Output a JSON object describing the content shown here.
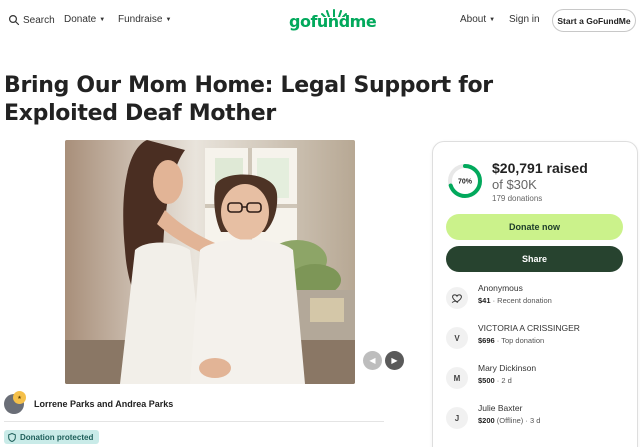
{
  "nav": {
    "search": "Search",
    "donate": "Donate",
    "fundraise": "Fundraise",
    "logo": "gofundme",
    "about": "About",
    "signin": "Sign in",
    "start": "Start a GoFundMe"
  },
  "campaign": {
    "title": "Bring Our Mom Home: Legal Support for Exploited Deaf Mother",
    "organizers": "Lorrene Parks and Andrea Parks",
    "protected": "Donation protected"
  },
  "progress": {
    "percent_label": "70%",
    "percent": 0.7,
    "raised": "$20,791 raised",
    "goal": "of $30K",
    "donations": "179 donations"
  },
  "actions": {
    "donate": "Donate now",
    "share": "Share"
  },
  "donations": [
    {
      "initial": "",
      "name": "Anonymous",
      "amount": "$41",
      "note": " · Recent donation"
    },
    {
      "initial": "V",
      "name": "VICTORIA A CRISSINGER",
      "amount": "$696",
      "note": " · Top donation"
    },
    {
      "initial": "M",
      "name": "Mary Dickinson",
      "amount": "$500",
      "note": " · 2 d"
    },
    {
      "initial": "J",
      "name": "Julie Baxter",
      "amount": "$200",
      "note": " (Offline) · 3 d"
    }
  ],
  "colors": {
    "brand_green": "#02a95c",
    "donate_button": "#cbf28b",
    "share_button": "#27432f",
    "ring_track": "#e8e8e8",
    "ring_fill": "#02a95c",
    "protected_badge": "#c9ebe8"
  },
  "icons": {
    "search": "search-icon",
    "heart_hand": "heart-hand-icon",
    "shield": "shield-icon",
    "prev": "chevron-left-icon",
    "next": "chevron-right-icon"
  }
}
